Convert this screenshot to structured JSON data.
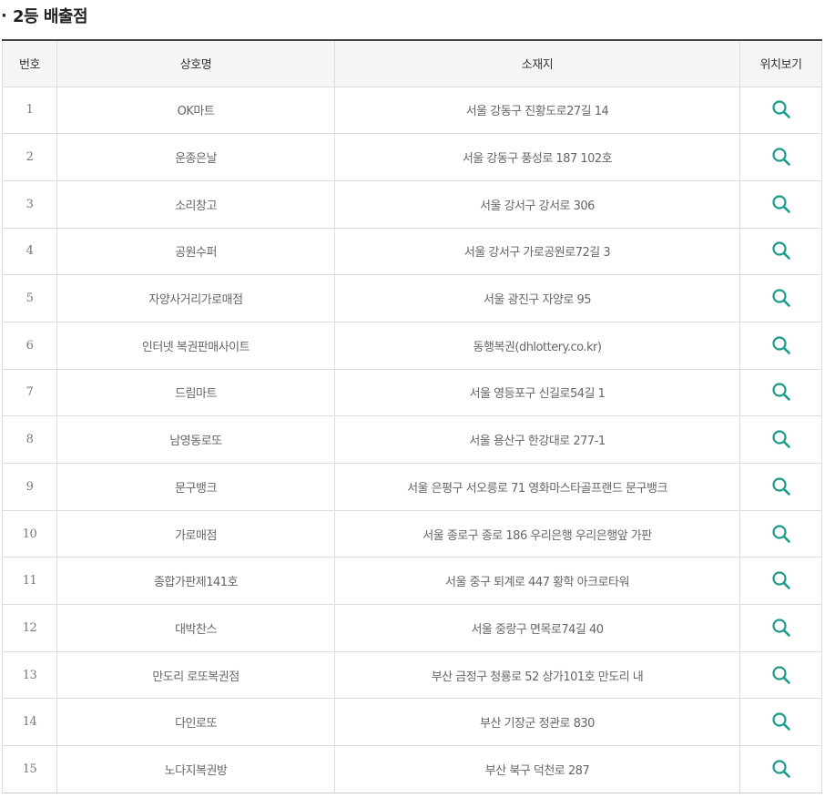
{
  "section": {
    "bullet": "·",
    "title": "2등 배출점"
  },
  "table": {
    "headers": {
      "number": "번호",
      "name": "상호명",
      "address": "소재지",
      "location": "위치보기"
    },
    "icon": "search-icon",
    "icon_color": "#1a9c8a",
    "rows": [
      {
        "number": "1",
        "name": "OK마트",
        "address": "서울 강동구 진황도로27길 14"
      },
      {
        "number": "2",
        "name": "운종은날",
        "address": "서울 강동구 풍성로 187 102호"
      },
      {
        "number": "3",
        "name": "소리창고",
        "address": "서울 강서구 강서로 306"
      },
      {
        "number": "4",
        "name": "공원수퍼",
        "address": "서울 강서구 가로공원로72길 3"
      },
      {
        "number": "5",
        "name": "자양사거리가로매점",
        "address": "서울 광진구 자양로 95"
      },
      {
        "number": "6",
        "name": "인터넷 복권판매사이트",
        "address": "동행복권(dhlottery.co.kr)"
      },
      {
        "number": "7",
        "name": "드림마트",
        "address": "서울 영등포구 신길로54길 1"
      },
      {
        "number": "8",
        "name": "남영동로또",
        "address": "서울 용산구 한강대로 277-1"
      },
      {
        "number": "9",
        "name": "문구뱅크",
        "address": "서울 은평구 서오릉로 71 영화마스타골프랜드 문구뱅크"
      },
      {
        "number": "10",
        "name": "가로매점",
        "address": "서울 종로구 종로 186 우리은행 우리은행앞 가판"
      },
      {
        "number": "11",
        "name": "종합가판제141호",
        "address": "서울 중구 퇴계로 447 황학 아크로타워"
      },
      {
        "number": "12",
        "name": "대박찬스",
        "address": "서울 중랑구 면목로74길 40"
      },
      {
        "number": "13",
        "name": "만도리 로또복권점",
        "address": "부산 금정구 청룡로 52 상가101호 만도리 내"
      },
      {
        "number": "14",
        "name": "다인로또",
        "address": "부산 기장군 정관로 830"
      },
      {
        "number": "15",
        "name": "노다지복권방",
        "address": "부산 북구 덕천로 287"
      }
    ]
  }
}
